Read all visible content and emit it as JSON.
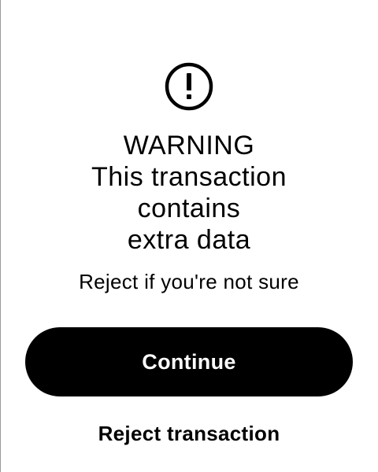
{
  "warning": {
    "icon": "exclamation-circle-icon",
    "title_lines": [
      "WARNING",
      "This transaction",
      "contains",
      "extra data"
    ],
    "subtitle": "Reject if you're not sure"
  },
  "actions": {
    "continue_label": "Continue",
    "reject_label": "Reject transaction"
  },
  "colors": {
    "background": "#ffffff",
    "text": "#000000",
    "primary_button": "#000000",
    "primary_button_text": "#ffffff"
  }
}
